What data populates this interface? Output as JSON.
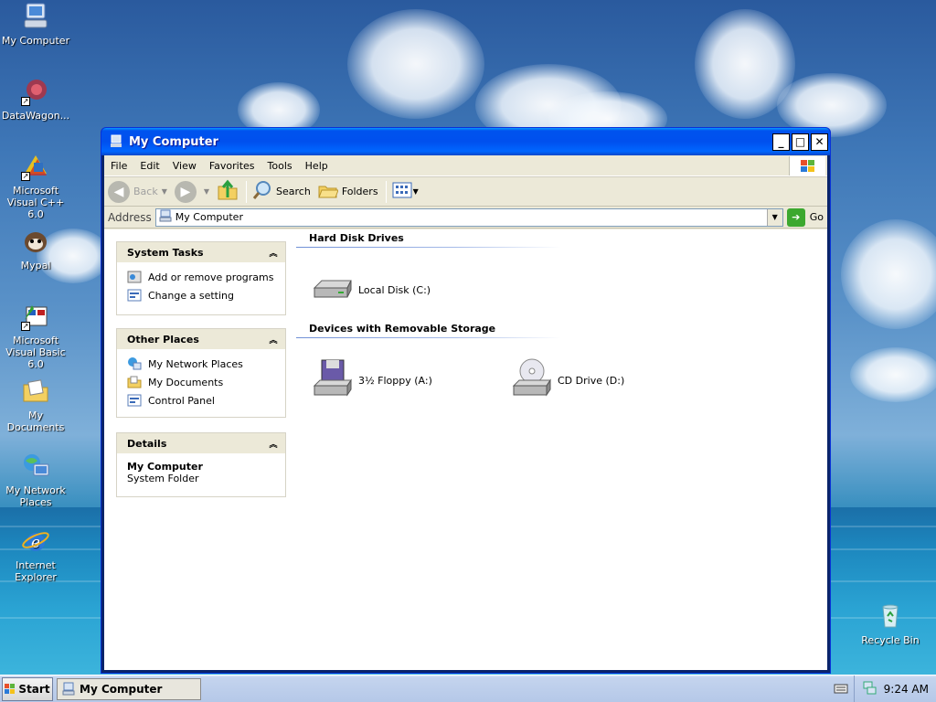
{
  "desktop": {
    "icons": [
      {
        "label": "My Computer",
        "icon": "my-computer-icon"
      },
      {
        "label": "DataWagon...",
        "icon": "datawagon-icon"
      },
      {
        "label": "Microsoft Visual C++ 6.0",
        "icon": "visual-cpp-icon"
      },
      {
        "label": "Mypal",
        "icon": "mypal-icon"
      },
      {
        "label": "Microsoft Visual Basic 6.0",
        "icon": "visual-basic-icon"
      },
      {
        "label": "My Documents",
        "icon": "my-documents-icon"
      },
      {
        "label": "My Network Places",
        "icon": "network-places-icon"
      },
      {
        "label": "Internet Explorer",
        "icon": "internet-explorer-icon"
      },
      {
        "label": "Recycle Bin",
        "icon": "recycle-bin-icon"
      }
    ]
  },
  "window": {
    "title": "My Computer",
    "menu": [
      "File",
      "Edit",
      "View",
      "Favorites",
      "Tools",
      "Help"
    ],
    "toolbar": {
      "back": "Back",
      "search": "Search",
      "folders": "Folders"
    },
    "address": {
      "label": "Address",
      "value": "My Computer",
      "go": "Go"
    },
    "tasks": {
      "system_tasks": {
        "title": "System Tasks",
        "items": [
          "Add or remove programs",
          "Change a setting"
        ]
      },
      "other_places": {
        "title": "Other Places",
        "items": [
          "My Network Places",
          "My Documents",
          "Control Panel"
        ]
      },
      "details": {
        "title": "Details",
        "name": "My Computer",
        "type": "System Folder"
      }
    },
    "groups": {
      "hard_disks": {
        "title": "Hard Disk Drives",
        "drives": [
          "Local Disk (C:)"
        ]
      },
      "removable": {
        "title": "Devices with Removable Storage",
        "drives": [
          "3½ Floppy (A:)",
          "CD Drive (D:)"
        ]
      }
    }
  },
  "taskbar": {
    "start": "Start",
    "active_task": "My Computer",
    "clock": "9:24 AM"
  }
}
